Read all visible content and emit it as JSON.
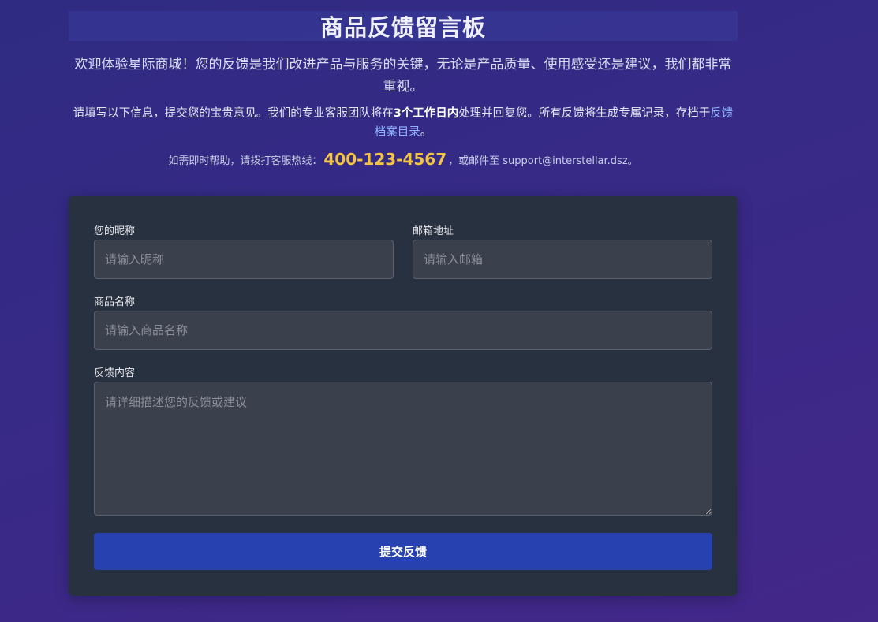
{
  "header": {
    "title": "商品反馈留言板",
    "intro": "欢迎体验星际商城！您的反馈是我们改进产品与服务的关键，无论是产品质量、使用感受还是建议，我们都非常重视。",
    "info_prefix": "请填写以下信息，提交您的宝贵意见。我们的专业客服团队将在",
    "info_bold": "3个工作日内",
    "info_middle": "处理并回复您。所有反馈将生成专属记录，存档于",
    "info_link": "反馈档案目录",
    "info_suffix": "。",
    "hotline_prefix": "如需即时帮助，请拨打客服热线：",
    "hotline_phone": "400-123-4567",
    "hotline_suffix": "，或邮件至 support@interstellar.dsz。"
  },
  "form": {
    "nickname_label": "您的昵称",
    "nickname_placeholder": "请输入昵称",
    "email_label": "邮箱地址",
    "email_placeholder": "请输入邮箱",
    "product_label": "商品名称",
    "product_placeholder": "请输入商品名称",
    "content_label": "反馈内容",
    "content_placeholder": "请详细描述您的反馈或建议",
    "submit_label": "提交反馈"
  },
  "colors": {
    "accent": "#2741b0",
    "phone": "#f4c542",
    "link": "#8fb3ff",
    "card": "#283140"
  }
}
